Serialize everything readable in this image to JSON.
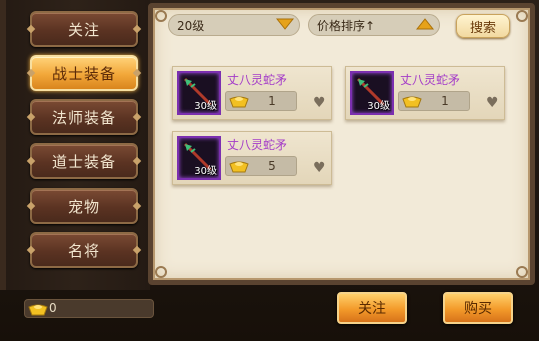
{
  "sidebar": {
    "items": [
      {
        "label": "关注",
        "active": false
      },
      {
        "label": "战士装备",
        "active": true
      },
      {
        "label": "法师装备",
        "active": false
      },
      {
        "label": "道士装备",
        "active": false
      },
      {
        "label": "宠物",
        "active": false
      },
      {
        "label": "名将",
        "active": false
      }
    ]
  },
  "filters": {
    "level": {
      "value": "20级",
      "icon": "chevron-down-icon"
    },
    "sort": {
      "value": "价格排序↑",
      "icon": "chevron-up-icon"
    },
    "search_label": "搜索"
  },
  "items": [
    {
      "name": "丈八灵蛇矛",
      "level": "30级",
      "price": "1",
      "icon": "spear-icon",
      "favorite_icon": "heart-icon"
    },
    {
      "name": "丈八灵蛇矛",
      "level": "30级",
      "price": "1",
      "icon": "spear-icon",
      "favorite_icon": "heart-icon"
    },
    {
      "name": "丈八灵蛇矛",
      "level": "30级",
      "price": "5",
      "icon": "spear-icon",
      "favorite_icon": "heart-icon"
    }
  ],
  "footer": {
    "currency": "0",
    "follow_label": "关注",
    "buy_label": "购买"
  },
  "colors": {
    "accent_gold": "#f39a2a",
    "item_name": "#a43cc8",
    "parchment": "#f2ead8"
  }
}
